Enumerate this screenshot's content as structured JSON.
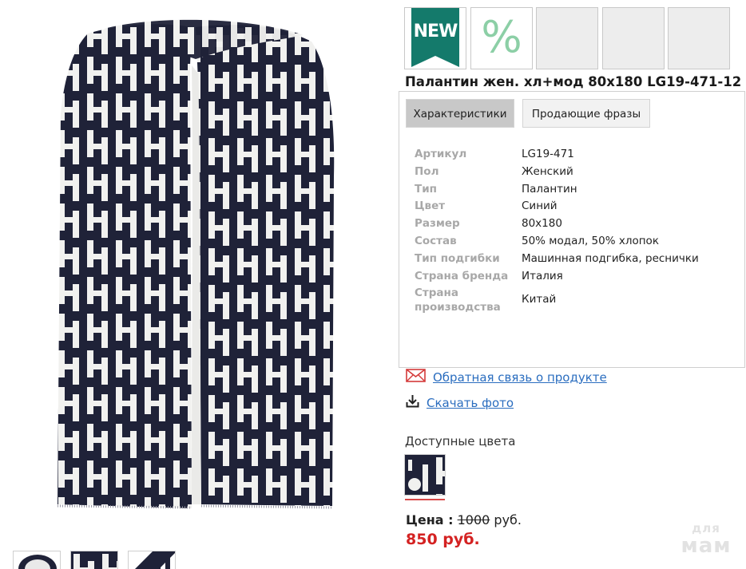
{
  "product": {
    "title": "Палантин жен. хл+мод 80х180 LG19-471-12",
    "image_icon": "scarf-pattern-image"
  },
  "badges": {
    "new_label": "NEW",
    "sale_label": "%",
    "new_color": "#147a6b",
    "sale_color": "#8ccfa6"
  },
  "tabs": [
    {
      "label": "Характеристики",
      "active": true
    },
    {
      "label": "Продающие фразы",
      "active": false
    }
  ],
  "specs": [
    {
      "key": "Артикул",
      "value": "LG19-471"
    },
    {
      "key": "Пол",
      "value": "Женский"
    },
    {
      "key": "Тип",
      "value": "Палантин"
    },
    {
      "key": "Цвет",
      "value": "Синий"
    },
    {
      "key": "Размер",
      "value": "80х180"
    },
    {
      "key": "Состав",
      "value": "50% модал, 50% хлопок"
    },
    {
      "key": "Тип подгибки",
      "value": "Машинная подгибка, реснички"
    },
    {
      "key": "Страна бренда",
      "value": "Италия"
    },
    {
      "key": "Страна производства",
      "value": "Китай"
    }
  ],
  "links": {
    "feedback": "Обратная связь о продукте",
    "download": "Скачать фото",
    "link_color": "#2a6dbf"
  },
  "colors": {
    "label": "Доступные цвета",
    "selected_accent": "#d84a4a"
  },
  "price": {
    "label": "Цена :",
    "old_value": "1000",
    "currency": "руб.",
    "new_price": "850 руб.",
    "new_price_color": "#d42222"
  },
  "watermark": {
    "line1": "для",
    "line2": "мам"
  }
}
